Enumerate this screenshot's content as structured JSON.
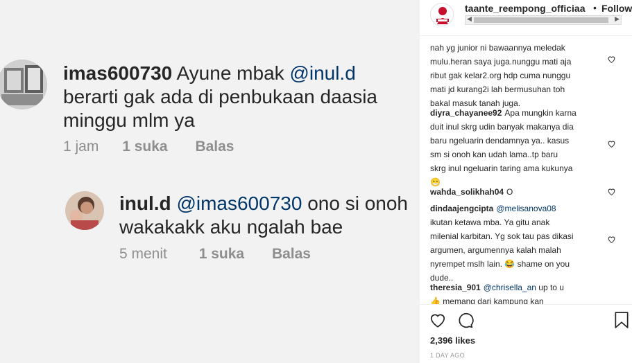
{
  "screenshot_comments": [
    {
      "username": "imas600730",
      "lines": [
        {
          "text": "Ayune mbak ",
          "mention": "@inul.d"
        },
        {
          "text": "berarti gak ada di penbukaan daasia"
        },
        {
          "text": "minggu mlm ya"
        }
      ],
      "time": "1 jam",
      "likes": "1 suka",
      "reply": "Balas"
    },
    {
      "username": "inul.d",
      "lines": [
        {
          "mention": "@imas600730",
          "text": " ono si onoh"
        },
        {
          "text": "wakakakk aku ngalah bae"
        }
      ],
      "time": "5 menit",
      "likes": "1 suka",
      "reply": "Balas"
    }
  ],
  "header": {
    "username": "taante_reempong_officiaa",
    "separator": "•",
    "follow_label": "Following"
  },
  "comments": [
    {
      "user": "",
      "lines": [
        "nah yg junior ni bawaannya meledak",
        "mulu.heran saya juga.nunggu mati aja",
        "ribut gak kelar2.org hdp cuma nunggu",
        "mati jd kurang2i lah bermusuhan toh",
        "bakal masuk tanah juga."
      ]
    },
    {
      "user": "diyra_chayanee92",
      "lines": [
        "Apa mungkin karna",
        "duit inul skrg udin banyak makanya dia",
        "baru ngeluarin dendamnya ya.. kasus",
        "sm si onoh kan udah lama..tp baru",
        "skrg inul ngeluarin taring ama kukunya",
        "😁"
      ]
    },
    {
      "user": "wahda_solikhah04",
      "lines": [
        "O"
      ]
    },
    {
      "user": "dindaajengcipta",
      "mention": "@melisanova08",
      "lines": [
        "ikutan ketawa mba. Ya gitu anak",
        "milenial karbitan. Yg sok tau pas dikasi",
        "argumen, argumennya kalah malah",
        "nyrempet mslh lain. 😂 shame on you",
        "dude.."
      ]
    },
    {
      "user": "theresia_901",
      "mention": "@chrisella_an",
      "after_mention": " up to u",
      "lines": [
        "👍 memang dari kampung kan"
      ]
    }
  ],
  "likes_text": "2,396 likes",
  "posted_time": "1 DAY AGO",
  "colors": {
    "mention": "#003569",
    "meta": "#8e8e8e",
    "text": "#262626",
    "border": "#efefef"
  },
  "icons": [
    "heart-icon",
    "comment-icon",
    "bookmark-icon",
    "like-heart-icon"
  ]
}
